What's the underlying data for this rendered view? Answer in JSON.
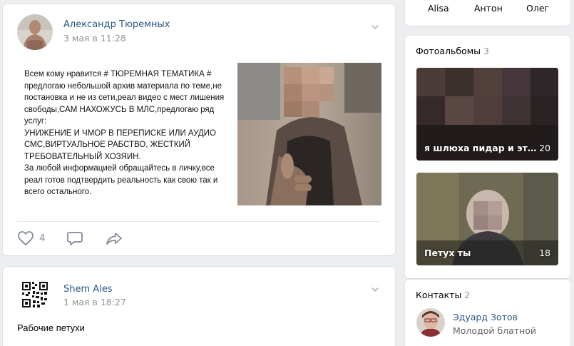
{
  "post1": {
    "author": "Александр Тюремных",
    "date": "3 мая в 11:28",
    "text": [
      "Всем кому нравится  # ТЮРЕМНАЯ ТЕМАТИКА # предлогаю небольшой архив материала по теме,не постановка и не из сети,реал видео с мест лишения свободы,САМ НАХОЖУСЬ В МЛС,предлогаю  ряд услуг:",
      "УНИЖЕНИЕ И ЧМОР В ПЕРЕПИСКЕ ИЛИ АУДИО СМС,ВИРТУАЛЬНОЕ РАБСТВО, ЖЕСТКИЙ ТРЕБОВАТЕЛЬНЫЙ ХОЗЯИН.",
      "За любой информацией обращайтесь в личку,все реал   готов подтвердить реальность как свою так и всего остального."
    ],
    "likes": "4",
    "icons": {
      "like": "heart-icon",
      "comment": "comment-icon",
      "share": "share-icon",
      "menu": "chevron-down-icon"
    }
  },
  "post2": {
    "author": "Shem Ales",
    "date": "1 мая в 18:27",
    "text": "Рабочие петухи"
  },
  "friends": {
    "names": [
      "Alisa",
      "Антон",
      "Олег"
    ]
  },
  "albums": {
    "title": "Фотоальбомы",
    "count": "3",
    "items": [
      {
        "title": "я шлюха пидар и это м...",
        "count": "20"
      },
      {
        "title": "Петух ты",
        "count": "18"
      }
    ]
  },
  "contacts": {
    "title": "Контакты",
    "count": "2",
    "items": [
      {
        "name": "Эдуард Зотов",
        "status": "Молодой блатной"
      }
    ]
  },
  "colors": {
    "link": "#2a5885",
    "muted": "#939393",
    "background": "#edeef0",
    "icon": "#828a99"
  }
}
